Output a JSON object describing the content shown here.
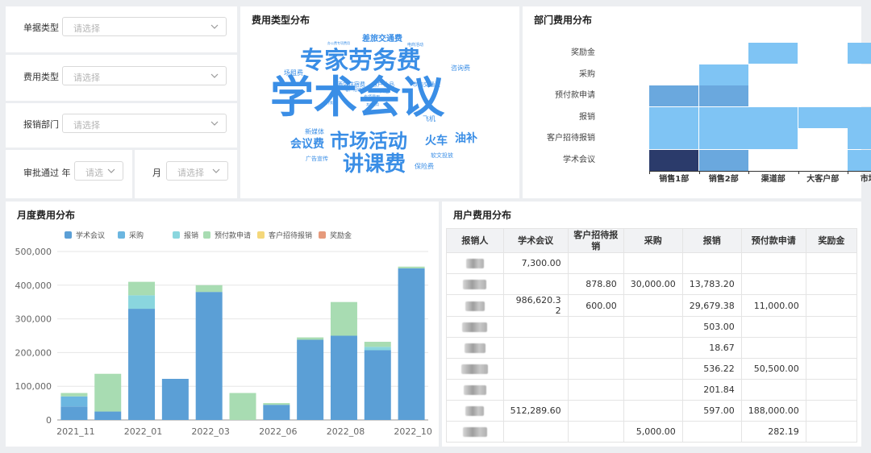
{
  "filters": {
    "doc_type": {
      "label": "单据类型",
      "placeholder": "请选择"
    },
    "expense_type": {
      "label": "费用类型",
      "placeholder": "请选择"
    },
    "dept": {
      "label": "报销部门",
      "placeholder": "请选择"
    },
    "approval_year": {
      "label": "审批通过 年",
      "placeholder": "请选"
    },
    "month": {
      "label": "月",
      "placeholder": "请选择"
    }
  },
  "wordcloud": {
    "title": "费用类型分布",
    "words": [
      {
        "text": "学术会议",
        "size": 54,
        "color": "#3a8ee6"
      },
      {
        "text": "专家劳务费",
        "size": 30,
        "color": "#3a8ee6"
      },
      {
        "text": "讲课费",
        "size": 26,
        "color": "#3a8ee6"
      },
      {
        "text": "市场活动",
        "size": 24,
        "color": "#3a8ee6"
      },
      {
        "text": "会议费",
        "size": 14,
        "color": "#3a8ee6"
      },
      {
        "text": "火车",
        "size": 14,
        "color": "#3a8ee6"
      },
      {
        "text": "油补",
        "size": 14,
        "color": "#3a8ee6"
      },
      {
        "text": "差旅交通费",
        "size": 10,
        "color": "#3a8ee6"
      },
      {
        "text": "咨询费",
        "size": 8,
        "color": "#3a8ee6"
      },
      {
        "text": "场租费",
        "size": 8,
        "color": "#3a8ee6"
      },
      {
        "text": "新媒体",
        "size": 8,
        "color": "#3a8ee6"
      },
      {
        "text": "广告宣传",
        "size": 7,
        "color": "#3a8ee6"
      },
      {
        "text": "软文投放",
        "size": 7,
        "color": "#3a8ee6"
      },
      {
        "text": "保险费",
        "size": 8,
        "color": "#3a8ee6"
      },
      {
        "text": "飞机",
        "size": 8,
        "color": "#3a8ee6"
      },
      {
        "text": "酒店住宿费",
        "size": 7,
        "color": "#3a8ee6"
      },
      {
        "text": "客户礼品",
        "size": 7,
        "color": "#3a8ee6"
      },
      {
        "text": "市内交通费",
        "size": 7,
        "color": "#3a8ee6"
      },
      {
        "text": "电商活动",
        "size": 5,
        "color": "#3a8ee6"
      },
      {
        "text": "办公费专项费用",
        "size": 4,
        "color": "#3a8ee6"
      },
      {
        "text": "大巴",
        "size": 6,
        "color": "#3a8ee6"
      },
      {
        "text": "客户招待费",
        "size": 5,
        "color": "#3a8ee6"
      },
      {
        "text": "专项费用",
        "size": 5,
        "color": "#3a8ee6"
      },
      {
        "text": "宣传策划",
        "size": 4,
        "color": "#3a8ee6"
      },
      {
        "text": "其他费用",
        "size": 4,
        "color": "#3a8ee6"
      }
    ]
  },
  "heatmap": {
    "title": "部门费用分布",
    "rows": [
      "奖励金",
      "采购",
      "预付款申请",
      "报销",
      "客户招待报销",
      "学术会议"
    ],
    "cols": [
      "销售1部",
      "销售2部",
      "渠道部",
      "大客户部",
      "市场部"
    ],
    "colors": {
      "empty": "#ffffff",
      "light": "#7fc4f4",
      "mid": "#6aa8de",
      "dark": "#2b3b6b"
    }
  },
  "chart_data": {
    "type": "bar",
    "title": "月度费用分布",
    "xlabel": "",
    "ylabel": "",
    "ylim": [
      0,
      500000
    ],
    "yticks": [
      "0",
      "100,000",
      "200,000",
      "300,000",
      "400,000",
      "500,000"
    ],
    "xtick_labels": [
      "2021_11",
      "2022_01",
      "2022_03",
      "2022_06",
      "2022_08",
      "2022_10"
    ],
    "categories": [
      "2021_11",
      "2021_12",
      "2022_01",
      "2022_02",
      "2022_03",
      "2022_05",
      "2022_06",
      "2022_07",
      "2022_08",
      "2022_09",
      "2022_10"
    ],
    "stacked": true,
    "series": [
      {
        "name": "学术会议",
        "color": "#5b9fd6",
        "values": [
          40000,
          25000,
          330000,
          122000,
          380000,
          0,
          45000,
          238000,
          250000,
          207000,
          450000
        ]
      },
      {
        "name": "采购",
        "color": "#6bb6e0",
        "values": [
          30000,
          0,
          0,
          0,
          0,
          0,
          0,
          0,
          0,
          0,
          0
        ]
      },
      {
        "name": "报销",
        "color": "#8ad6de",
        "values": [
          0,
          0,
          40000,
          0,
          0,
          0,
          0,
          0,
          0,
          10000,
          0
        ]
      },
      {
        "name": "预付款申请",
        "color": "#a8dcb2",
        "values": [
          10000,
          112000,
          40000,
          0,
          20000,
          80000,
          5000,
          7000,
          100000,
          15000,
          5000
        ]
      },
      {
        "name": "客户招待报销",
        "color": "#f4d77a",
        "values": [
          0,
          0,
          0,
          0,
          0,
          0,
          0,
          0,
          0,
          0,
          0
        ]
      },
      {
        "name": "奖励金",
        "color": "#e69a7c",
        "values": [
          0,
          0,
          0,
          0,
          0,
          0,
          0,
          0,
          0,
          0,
          0
        ]
      }
    ],
    "grid": true,
    "legend": "top"
  },
  "user_table": {
    "title": "用户费用分布",
    "headers": [
      "报销人",
      "学术会议",
      "客户招待报\n销",
      "采购",
      "报销",
      "预付款申请",
      "奖励金"
    ],
    "rows": [
      [
        "",
        "7,300.00",
        "",
        "",
        "",
        "",
        ""
      ],
      [
        "",
        "",
        "878.80",
        "30,000.00",
        "13,783.20",
        "",
        ""
      ],
      [
        "",
        "986,620.3\n2",
        "600.00",
        "",
        "29,679.38",
        "11,000.00",
        ""
      ],
      [
        "",
        "",
        "",
        "",
        "503.00",
        "",
        ""
      ],
      [
        "",
        "",
        "",
        "",
        "18.67",
        "",
        ""
      ],
      [
        "",
        "",
        "",
        "",
        "536.22",
        "50,500.00",
        ""
      ],
      [
        "",
        "",
        "",
        "",
        "201.84",
        "",
        ""
      ],
      [
        "",
        "512,289.60",
        "",
        "",
        "597.00",
        "188,000.00",
        ""
      ],
      [
        "",
        "",
        "",
        "5,000.00",
        "",
        "282.19",
        ""
      ]
    ]
  }
}
